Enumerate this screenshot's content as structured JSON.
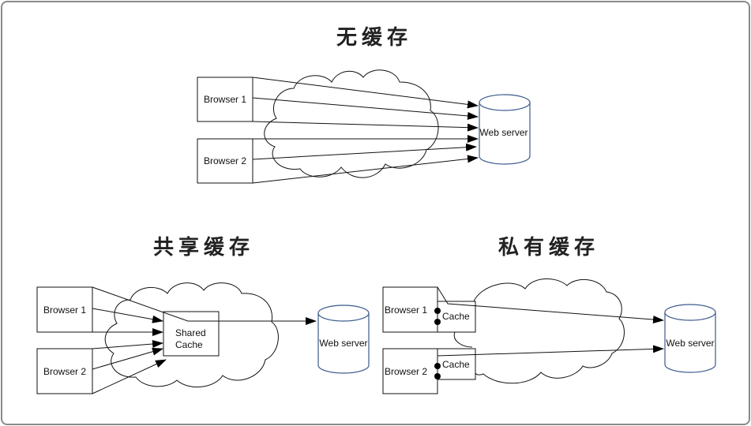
{
  "colors": {
    "line": "#111111",
    "server_stroke": "#3b5a8c",
    "frame": "#8a8a8a",
    "title": "#222222"
  },
  "sections": {
    "no_cache": {
      "title": "无缓存",
      "browser1": "Browser 1",
      "browser2": "Browser 2",
      "server": "Web server"
    },
    "shared_cache": {
      "title": "共享缓存",
      "browser1": "Browser 1",
      "browser2": "Browser 2",
      "cache_line1": "Shared",
      "cache_line2": "Cache",
      "server": "Web server"
    },
    "private_cache": {
      "title": "私有缓存",
      "browser1": "Browser 1",
      "browser2": "Browser 2",
      "cache1": "Cache",
      "cache2": "Cache",
      "server": "Web server"
    }
  }
}
